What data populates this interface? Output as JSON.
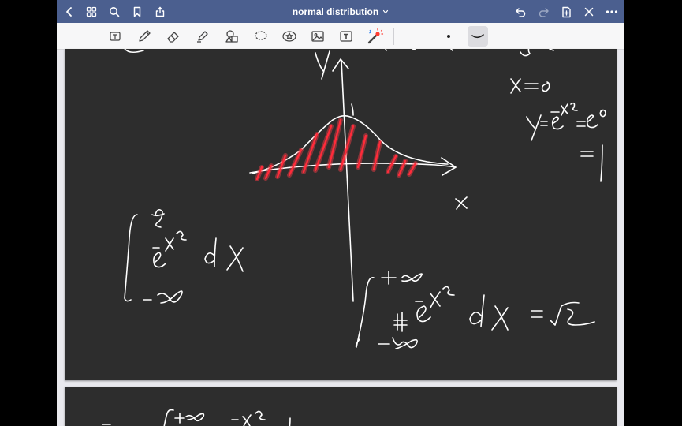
{
  "titlebar": {
    "title": "normal distribution",
    "title_chevron_icon": "chevron-down-icon",
    "left_icons": [
      "back-icon",
      "grid-icon",
      "search-icon",
      "bookmark-icon",
      "share-icon"
    ],
    "right_icons": [
      "undo-icon",
      "redo-icon",
      "add-page-icon",
      "close-icon",
      "more-icon"
    ],
    "color": "#4b5f8f"
  },
  "toolbar": {
    "tools": [
      "text-scan-icon",
      "pen-icon",
      "eraser-icon",
      "highlighter-icon",
      "shapes-icon",
      "lasso-icon",
      "sticker-icon",
      "image-icon",
      "textbox-icon",
      "laser-pointer-icon"
    ],
    "active_stroke": "curve-stroke-icon"
  },
  "canvas": {
    "page_color": "#2d2d2d",
    "ink_color": "#ffffff",
    "highlight_color": "#ff2b3a"
  }
}
